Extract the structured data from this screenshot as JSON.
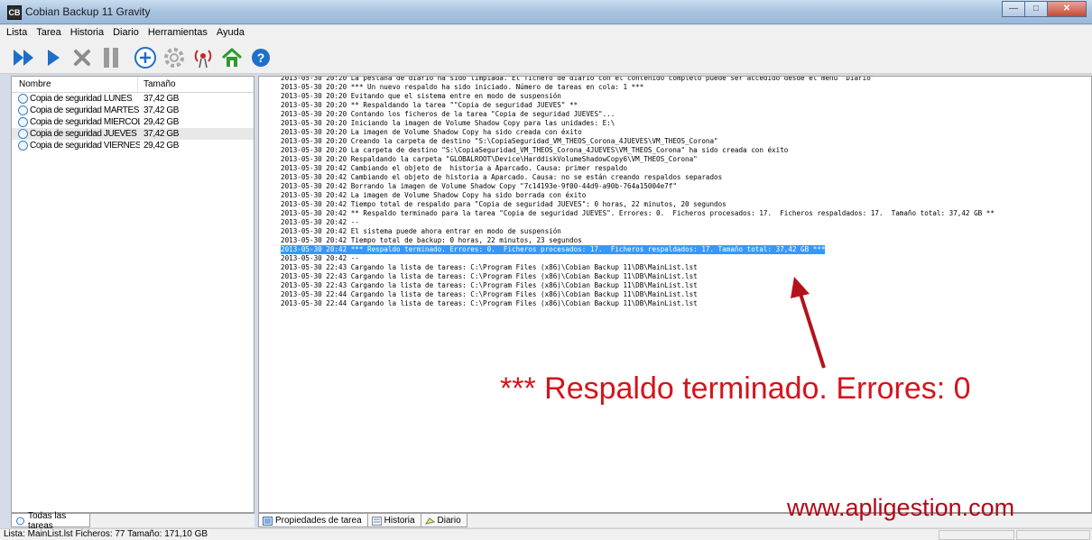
{
  "window": {
    "title": "Cobian Backup 11 Gravity",
    "app_icon_text": "CB"
  },
  "menu": [
    "Lista",
    "Tarea",
    "Historia",
    "Diario",
    "Herramientas",
    "Ayuda"
  ],
  "list": {
    "columns": {
      "name": "Nombre",
      "size": "Tamaño"
    },
    "tasks": [
      {
        "name": "Copia de seguridad LUNES",
        "size": "37,42 GB"
      },
      {
        "name": "Copia de seguridad MARTES",
        "size": "37,42 GB"
      },
      {
        "name": "Copia de seguridad MIERCOLES",
        "size": "29,42 GB"
      },
      {
        "name": "Copia de seguridad JUEVES",
        "size": "37,42 GB"
      },
      {
        "name": "Copia de seguridad VIERNES",
        "size": "29,42 GB"
      }
    ],
    "selected_index": 3
  },
  "log": {
    "lines": [
      "2013-05-30 20:20 La pestaña de diario ha sido limpiada. El fichero de diario con el contenido completo puede ser accedido desde el menú \"Diario\"",
      "2013-05-30 20:20 *** Un nuevo respaldo ha sido iniciado. Número de tareas en cola: 1 ***",
      "2013-05-30 20:20 Evitando que el sistema entre en modo de suspensión",
      "2013-05-30 20:20 ** Respaldando la tarea \"\"Copia de seguridad JUEVES\" **",
      "2013-05-30 20:20 Contando los ficheros de la tarea \"Copia de seguridad JUEVES\"...",
      "2013-05-30 20:20 Iniciando la imagen de Volume Shadow Copy para las unidades: E:\\",
      "2013-05-30 20:20 La imagen de Volume Shadow Copy ha sido creada con éxito",
      "2013-05-30 20:20 Creando la carpeta de destino \"S:\\CopiaSeguridad_VM_THEOS_Corona_4JUEVES\\VM_THEOS_Corona\"",
      "2013-05-30 20:20 La carpeta de destino \"S:\\CopiaSeguridad_VM_THEOS_Corona_4JUEVES\\VM_THEOS_Corona\" ha sido creada con éxito",
      "2013-05-30 20:20 Respaldando la carpeta \"GLOBALROOT\\Device\\HarddiskVolumeShadowCopy6\\VM_THEOS_Corona\"",
      "2013-05-30 20:42 Cambiando el objeto de  historia a Aparcado. Causa: primer respaldo",
      "2013-05-30 20:42 Cambiando el objeto de historia a Aparcado. Causa: no se están creando respaldos separados",
      "2013-05-30 20:42 Borrando la imagen de Volume Shadow Copy \"7c14193e-9f00-44d9-a90b-764a15004e7f\"",
      "2013-05-30 20:42 La imagen de Volume Shadow Copy ha sido borrada con éxito",
      "2013-05-30 20:42 Tiempo total de respaldo para \"Copia de seguridad JUEVES\": 0 horas, 22 minutos, 20 segundos",
      "2013-05-30 20:42 ** Respaldo terminado para la tarea \"Copia de seguridad JUEVES\". Errores: 0.  Ficheros procesados: 17.  Ficheros respaldados: 17.  Tamaño total: 37,42 GB **",
      "2013-05-30 20:42 --",
      "2013-05-30 20:42 El sistema puede ahora entrar en modo de suspensión",
      "2013-05-30 20:42 Tiempo total de backup: 0 horas, 22 minutos, 23 segundos",
      "2013-05-30 20:42 *** Respaldo terminado. Errores: 0.  Ficheros procesados: 17.  Ficheros respaldados: 17. Tamaño total: 37,42 GB ***",
      "2013-05-30 20:42 --",
      "2013-05-30 22:43 Cargando la lista de tareas: C:\\Program Files (x86)\\Cobian Backup 11\\DB\\MainList.lst",
      "2013-05-30 22:43 Cargando la lista de tareas: C:\\Program Files (x86)\\Cobian Backup 11\\DB\\MainList.lst",
      "2013-05-30 22:43 Cargando la lista de tareas: C:\\Program Files (x86)\\Cobian Backup 11\\DB\\MainList.lst",
      "2013-05-30 22:44 Cargando la lista de tareas: C:\\Program Files (x86)\\Cobian Backup 11\\DB\\MainList.lst",
      "2013-05-30 22:44 Cargando la lista de tareas: C:\\Program Files (x86)\\Cobian Backup 11\\DB\\MainList.lst"
    ],
    "highlighted_index": 19
  },
  "tabs_left": {
    "all_tasks": "Todas las tareas"
  },
  "tabs_right": {
    "properties": "Propiedades de tarea",
    "history": "Historia",
    "journal": "Diario"
  },
  "status": {
    "text": "Lista: MainList.lst   Ficheros: 77   Tamaño: 171,10 GB"
  },
  "annotation": {
    "text": "*** Respaldo terminado. Errores: 0",
    "color": "#d5141c"
  },
  "watermark": "www.apligestion.com",
  "colors": {
    "selection": "#3399ff",
    "accent": "#1e6fc8",
    "home_icon": "#2e9a2e"
  }
}
